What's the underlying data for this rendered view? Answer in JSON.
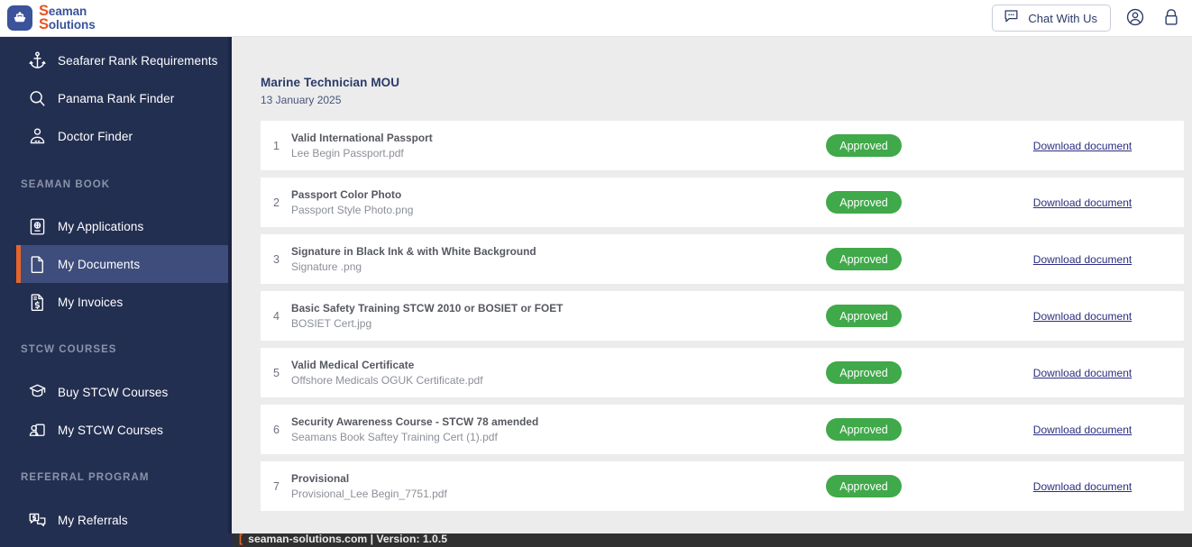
{
  "header": {
    "brand_line1": "Seaman",
    "brand_line2": "Solutions",
    "brand_cap1": "S",
    "brand_cap2": "S",
    "brand_rest1": "eaman",
    "brand_rest2": "olutions",
    "chat_label": "Chat With Us",
    "chat_icon": "chat-bubble-icon",
    "account_icon": "user-circle-icon",
    "lock_icon": "padlock-icon",
    "brand_color": "#3a539b",
    "brand_accent": "#e8541f"
  },
  "sidebar": {
    "background": "#232f51",
    "active_bg": "#3e4d7c",
    "active_marker": "#e8652a",
    "groups": [
      {
        "label": null,
        "items": [
          {
            "label": "Seafarer Rank Requirements",
            "icon": "anchor-icon",
            "active": false
          },
          {
            "label": "Panama Rank Finder",
            "icon": "search-icon",
            "active": false
          },
          {
            "label": "Doctor Finder",
            "icon": "doctor-icon",
            "active": false
          }
        ]
      },
      {
        "label": "SEAMAN BOOK",
        "items": [
          {
            "label": "My Applications",
            "icon": "passport-book-icon",
            "active": false
          },
          {
            "label": "My Documents",
            "icon": "document-icon",
            "active": true
          },
          {
            "label": "My Invoices",
            "icon": "invoice-dollar-icon",
            "active": false
          }
        ]
      },
      {
        "label": "STCW COURSES",
        "items": [
          {
            "label": "Buy STCW Courses",
            "icon": "graduation-cap-icon",
            "active": false
          },
          {
            "label": "My STCW Courses",
            "icon": "person-screen-icon",
            "active": false
          }
        ]
      },
      {
        "label": "REFERRAL PROGRAM",
        "items": [
          {
            "label": "My Referrals",
            "icon": "chat-dollar-icon",
            "active": false
          }
        ]
      }
    ]
  },
  "main": {
    "title": "Marine Technician MOU",
    "date": "13 January 2025",
    "status_label": "Approved",
    "status_color": "#40a94a",
    "download_label": "Download document",
    "documents": [
      {
        "num": "1",
        "title": "Valid International Passport",
        "file": "Lee Begin Passport.pdf",
        "status": "Approved",
        "action": "Download document"
      },
      {
        "num": "2",
        "title": "Passport Color Photo",
        "file": "Passport Style Photo.png",
        "status": "Approved",
        "action": "Download document"
      },
      {
        "num": "3",
        "title": "Signature in Black Ink & with White Background",
        "file": "Signature .png",
        "status": "Approved",
        "action": "Download document"
      },
      {
        "num": "4",
        "title": "Basic Safety Training STCW 2010 or BOSIET or FOET",
        "file": "BOSIET Cert.jpg",
        "status": "Approved",
        "action": "Download document"
      },
      {
        "num": "5",
        "title": "Valid Medical Certificate",
        "file": "Offshore Medicals OGUK Certificate.pdf",
        "status": "Approved",
        "action": "Download document"
      },
      {
        "num": "6",
        "title": "Security Awareness Course - STCW 78 amended",
        "file": "Seamans Book Saftey Training Cert (1).pdf",
        "status": "Approved",
        "action": "Download document"
      },
      {
        "num": "7",
        "title": "Provisional",
        "file": "Provisional_Lee Begin_7751.pdf",
        "status": "Approved",
        "action": "Download document"
      }
    ]
  },
  "statusbar": {
    "bracket": "[",
    "text": "seaman-solutions.com | Version: 1.0.5"
  }
}
